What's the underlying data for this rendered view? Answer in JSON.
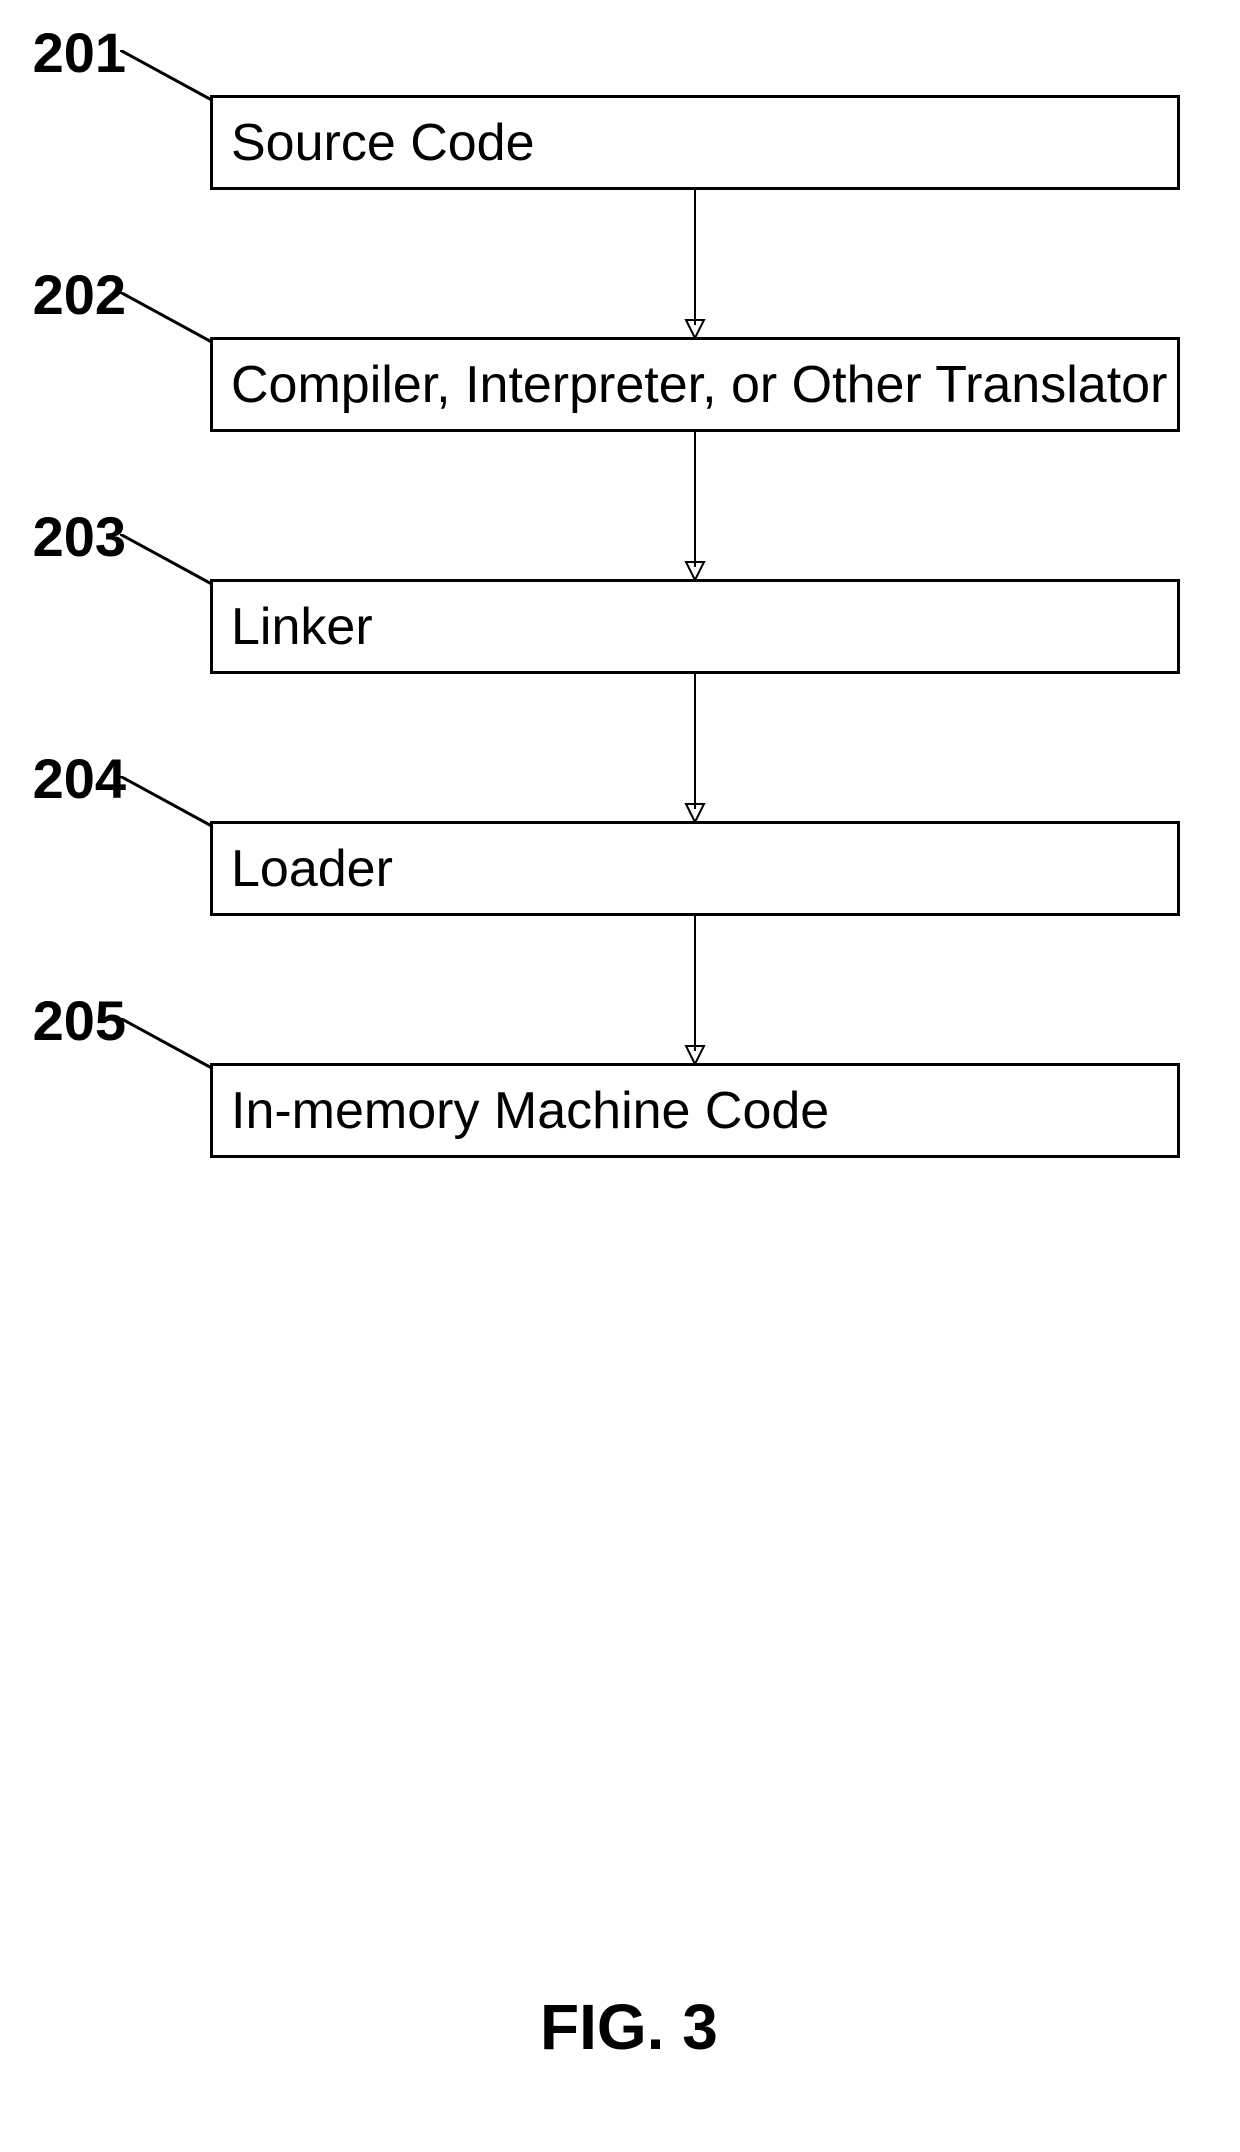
{
  "figure_label": "FIG. 3",
  "nodes": [
    {
      "id": "201",
      "label": "201",
      "box_text": "Source Code"
    },
    {
      "id": "202",
      "label": "202",
      "box_text": "Compiler, Interpreter, or Other Translator"
    },
    {
      "id": "203",
      "label": "203",
      "box_text": "Linker"
    },
    {
      "id": "204",
      "label": "204",
      "box_text": "Loader"
    },
    {
      "id": "205",
      "label": "205",
      "box_text": "In-memory Machine Code"
    }
  ]
}
